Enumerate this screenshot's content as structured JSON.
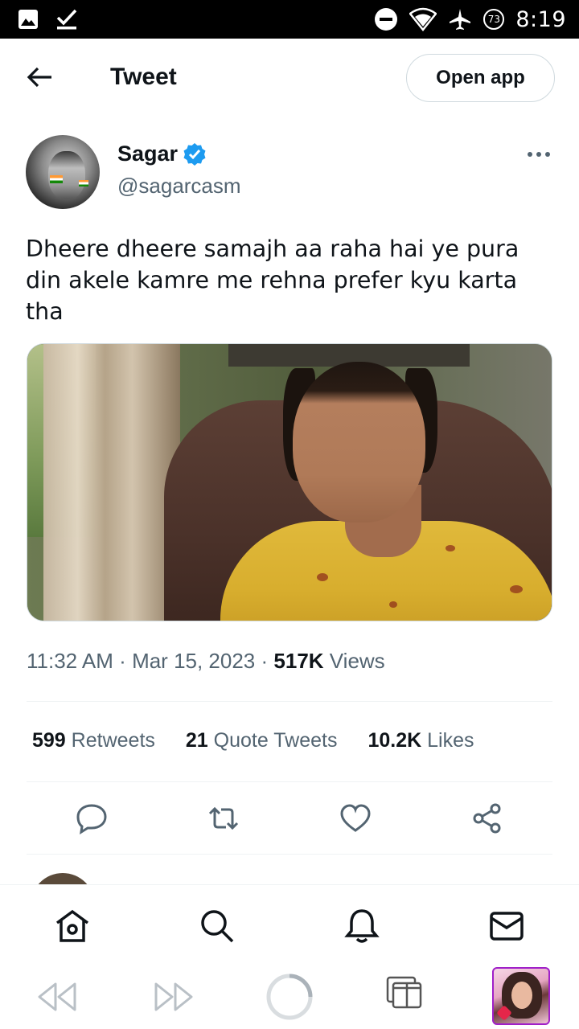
{
  "status_bar": {
    "time": "8:19",
    "battery": "73"
  },
  "header": {
    "title": "Tweet",
    "open_app_label": "Open app"
  },
  "tweet": {
    "author_name": "Sagar",
    "author_handle": "@sagarcasm",
    "text": "Dheere dheere samajh aa raha hai ye pura din akele kamre me rehna prefer kyu karta tha",
    "time": "11:32 AM",
    "date": "Mar 15, 2023",
    "views_count": "517K",
    "views_label": "Views",
    "retweets_count": "599",
    "retweets_label": "Retweets",
    "quote_count": "21",
    "quote_label": "Quote Tweets",
    "likes_count": "10.2K",
    "likes_label": "Likes"
  },
  "colors": {
    "accent": "#1d9bf0",
    "text": "#0f1419",
    "secondary": "#536471",
    "border": "#cfd9de"
  },
  "icons": {
    "status_left": [
      "image-icon",
      "check-icon"
    ],
    "status_right": [
      "dnd-icon",
      "wifi-icon",
      "airplane-icon",
      "battery-icon"
    ],
    "actions": [
      "reply-icon",
      "retweet-icon",
      "like-icon",
      "share-icon"
    ],
    "bottom_nav": [
      "home-icon",
      "search-icon",
      "notifications-icon",
      "messages-icon"
    ],
    "browser": [
      "rewind-icon",
      "fast-forward-icon",
      "reload-icon",
      "tabs-icon"
    ]
  }
}
